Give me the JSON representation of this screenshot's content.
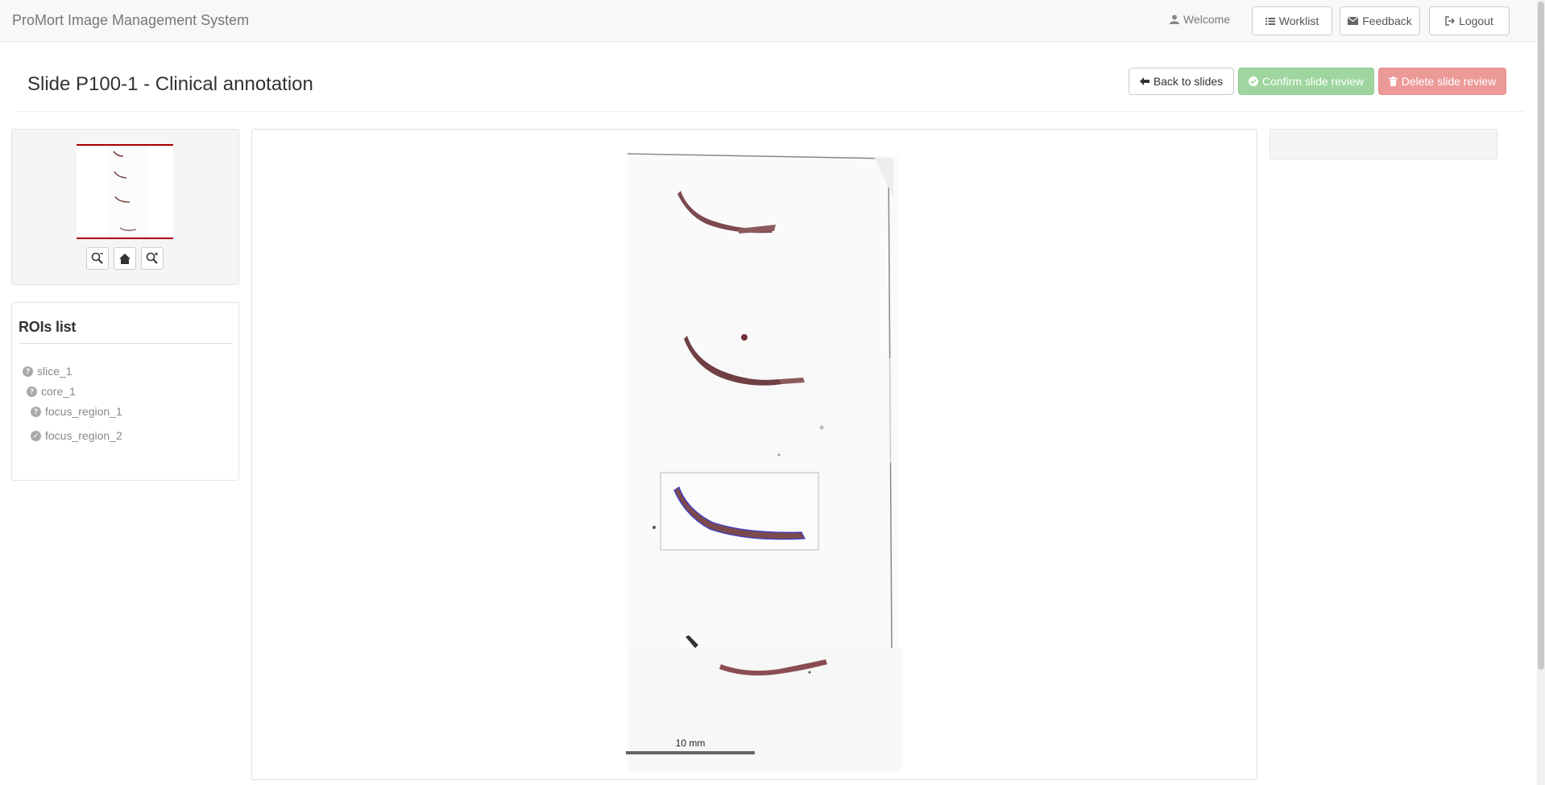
{
  "navbar": {
    "brand": "ProMort Image Management System",
    "welcome": "Welcome",
    "worklist": "Worklist",
    "feedback": "Feedback",
    "logout": "Logout"
  },
  "header": {
    "title": "Slide P100-1 - Clinical annotation",
    "back_button": "Back to slides",
    "confirm_button": "Confirm slide review",
    "delete_button": "Delete slide review"
  },
  "thumbnail": {
    "controls": [
      "zoom-out-icon",
      "home-icon",
      "zoom-in-icon"
    ]
  },
  "roi": {
    "title": "ROIs list",
    "items": [
      {
        "label": "slice_1",
        "status_icon": "question-circle-icon"
      },
      {
        "label": "core_1",
        "status_icon": "question-circle-icon"
      },
      {
        "label": "focus_region_1",
        "status_icon": "question-circle-icon"
      },
      {
        "label": "focus_region_2",
        "status_icon": "check-circle-icon"
      }
    ]
  },
  "viewer": {
    "scale_label": "10 mm"
  },
  "colors": {
    "success": "#9fd69f",
    "danger": "#eb9a98",
    "thumb_border": "#aa0000",
    "roi_outline": "#3a3acc"
  }
}
